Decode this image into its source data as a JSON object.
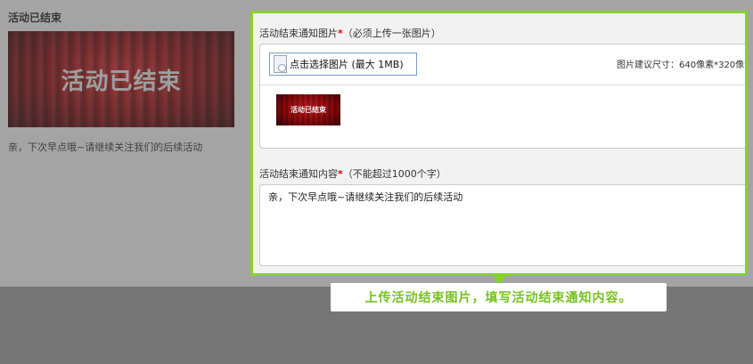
{
  "preview": {
    "title": "活动已结束",
    "banner_text": "活动已结束",
    "description": "亲，下次早点哦~请继续关注我们的后续活动"
  },
  "form": {
    "image_field": {
      "label": "活动结束通知图片",
      "required_mark": "*",
      "hint": "（必须上传一张图片）",
      "upload_button": "点击选择图片 (最大 1MB)",
      "size_hint": "图片建议尺寸：640像素*320像素",
      "thumb_text": "活动已结束"
    },
    "content_field": {
      "label": "活动结束通知内容",
      "required_mark": "*",
      "hint": "（不能超过1000个字）",
      "value": "亲，下次早点哦~请继续关注我们的后续活动"
    }
  },
  "tooltip": {
    "text": "上传活动结束图片，填写活动结束通知内容。"
  },
  "colors": {
    "highlight": "#86d12d",
    "tooltip_text": "#74c21f",
    "required": "#d50000"
  }
}
